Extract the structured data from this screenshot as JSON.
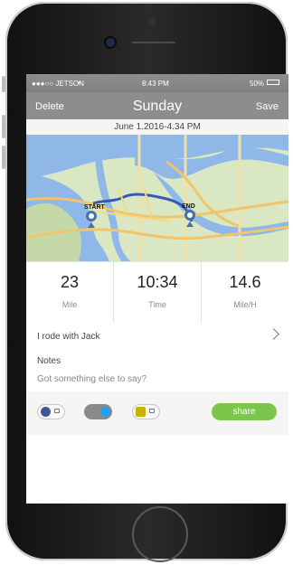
{
  "status": {
    "carrier": "●●●○○ JETSON",
    "time": "8:43 PM",
    "battery": "50%"
  },
  "nav": {
    "left": "Delete",
    "title": "Sunday",
    "right": "Save"
  },
  "date": "June 1.2016-4.34 PM",
  "map": {
    "start": "START",
    "end": "END"
  },
  "stats": [
    {
      "value": "23",
      "unit": "Mile"
    },
    {
      "value": "10:34",
      "unit": "Time"
    },
    {
      "value": "14.6",
      "unit": "Mile/H"
    }
  ],
  "companion": "I rode with Jack",
  "notes": {
    "heading": "Notes",
    "placeholder": "Got something else to say?"
  },
  "share": {
    "label": "share",
    "colors": {
      "share": "#7cc64b",
      "facebook": "#3b5998",
      "twitter": "#1da1f2",
      "instagram": "#c7b200"
    }
  }
}
